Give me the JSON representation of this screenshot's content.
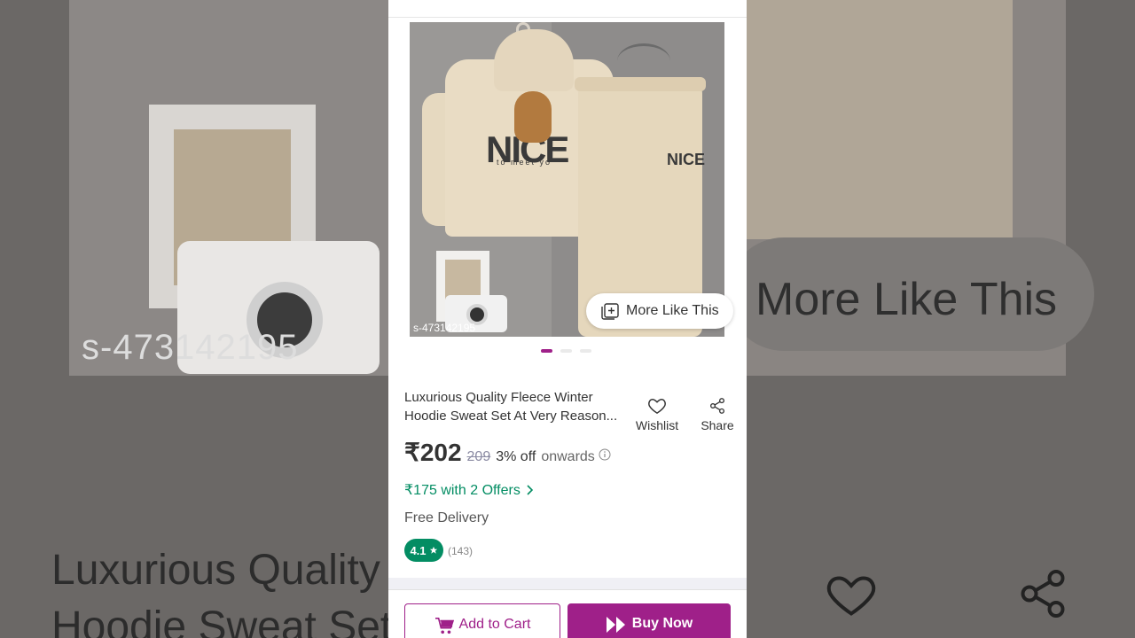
{
  "backdrop": {
    "code_text": "s-473142195",
    "pill_text": "More Like This",
    "title_line1": "Luxurious Quality",
    "title_line2": "Hoodie Sweat Set"
  },
  "product": {
    "image_code": "s-473142195",
    "hoodie_print": "NICE",
    "hoodie_subprint": "to meet yo",
    "pants_print": "NICE",
    "more_like_label": "More Like This",
    "title_line1": "Luxurious Quality Fleece Winter",
    "title_line2": "Hoodie Sweat Set At Very Reason...",
    "price": "₹202",
    "mrp": "209",
    "discount": "3% off",
    "onwards": "onwards",
    "offers": "₹175 with 2 Offers",
    "delivery": "Free Delivery",
    "rating": "4.1",
    "rating_count": "(143)",
    "carousel": {
      "count": 3,
      "active_index": 0
    }
  },
  "actions": {
    "wishlist_label": "Wishlist",
    "share_label": "Share"
  },
  "bottom_bar": {
    "add_to_cart": "Add to Cart",
    "buy_now": "Buy Now"
  },
  "colors": {
    "brand": "#9f2089",
    "green": "#038d63"
  },
  "icons": [
    "more-like-this-icon",
    "heart-icon",
    "share-icon",
    "info-icon",
    "chevron-right-icon",
    "star-icon",
    "cart-icon",
    "fast-forward-icon"
  ]
}
